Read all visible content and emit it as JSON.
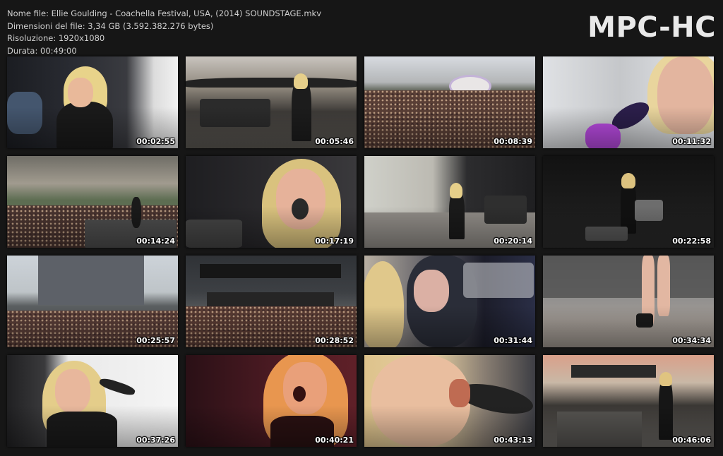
{
  "info": {
    "filename": "Nome file: Ellie Goulding - Coachella Festival, USA, (2014) SOUNDSTAGE.mkv",
    "filesize": "Dimensioni del file: 3,34 GB (3.592.382.276 bytes)",
    "resolution": "Risoluzione: 1920x1080",
    "duration": "Durata: 00:49:00"
  },
  "logo": "MPC-HC",
  "thumbnails": [
    {
      "time": "00:02:55",
      "scene": "singer-closeup-black-stage"
    },
    {
      "time": "00:05:46",
      "scene": "stage-wide-singer"
    },
    {
      "time": "00:08:39",
      "scene": "festival-crowd-wide"
    },
    {
      "time": "00:11:32",
      "scene": "singer-face-mic-closeup"
    },
    {
      "time": "00:14:24",
      "scene": "crowd-and-stage-wide"
    },
    {
      "time": "00:17:19",
      "scene": "singer-closeup-dark"
    },
    {
      "time": "00:20:14",
      "scene": "stage-wide-singer"
    },
    {
      "time": "00:22:58",
      "scene": "stage-band-dark"
    },
    {
      "time": "00:25:57",
      "scene": "stage-and-crowd-wide"
    },
    {
      "time": "00:28:52",
      "scene": "stage-and-crowd-wide"
    },
    {
      "time": "00:31:44",
      "scene": "singer-and-drummer-closeup"
    },
    {
      "time": "00:34:34",
      "scene": "singer-legs-stage"
    },
    {
      "time": "00:37:26",
      "scene": "singer-mic-white-bg"
    },
    {
      "time": "00:40:21",
      "scene": "singer-red-light"
    },
    {
      "time": "00:43:13",
      "scene": "singer-mic-extreme-closeup"
    },
    {
      "time": "00:46:06",
      "scene": "stage-sunset-singer"
    }
  ]
}
